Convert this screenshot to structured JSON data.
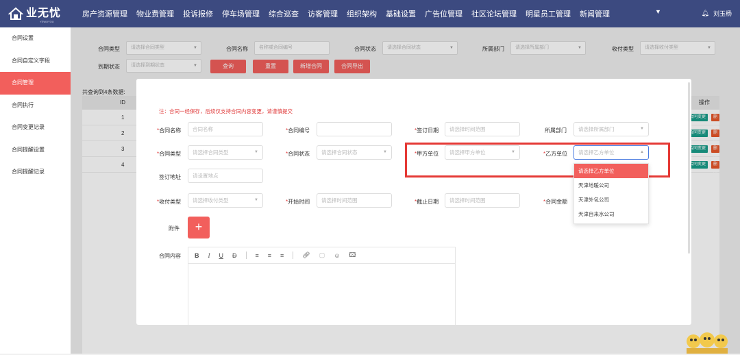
{
  "app": {
    "brand": "业无忧",
    "brand_sub": "YEWUYOU",
    "user": "刘玉杨"
  },
  "nav": [
    "房产资源管理",
    "物业费管理",
    "投诉报修",
    "停车场管理",
    "综合巡查",
    "访客管理",
    "组织架构",
    "基础设置",
    "广告位管理",
    "社区论坛管理",
    "明星员工管理",
    "新闻管理"
  ],
  "sidebar": [
    "合同设置",
    "合同自定义字段",
    "合同管理",
    "合同执行",
    "合同变更记录",
    "合同提醒设置",
    "合同提醒记录"
  ],
  "filters": {
    "contract_type_label": "合同类型",
    "contract_type_ph": "请选择合同类型",
    "contract_name_label": "合同名称",
    "contract_name_ph": "名称或合同编号",
    "contract_status_label": "合同状态",
    "contract_status_ph": "请选择合同状态",
    "dept_label": "所属部门",
    "dept_ph": "请选择所属部门",
    "pay_type_label": "收付类型",
    "pay_type_ph": "请选择收付类型",
    "expire_label": "到期状态",
    "expire_ph": "请选择到期状态",
    "btn_query": "查询",
    "btn_reset": "重置",
    "btn_add": "新增合同",
    "btn_export": "合同导出"
  },
  "table": {
    "summary": "共查询到4条数据:",
    "col_id": "ID",
    "col_action": "操作",
    "rows": [
      "1",
      "2",
      "3",
      "4"
    ],
    "btn_change": "合同变更",
    "btn_delete": "删除"
  },
  "modal": {
    "notice": "注：合同一经保存，后续仅支持合同内容变更，请谨慎提交",
    "name_label": "合同名称",
    "name_ph": "合同名称",
    "no_label": "合同编号",
    "sign_date_label": "签订日期",
    "sign_date_ph": "请选择时间范围",
    "dept_label": "所属部门",
    "dept_ph": "请选择所属部门",
    "type_label": "合同类型",
    "type_ph": "请选择合同类型",
    "status_label": "合同状态",
    "status_ph": "请选择合同状态",
    "party_a_label": "甲方单位",
    "party_a_ph": "请选择甲方单位",
    "party_b_label": "乙方单位",
    "party_b_ph": "请选择乙方单位",
    "addr_label": "签订地址",
    "addr_ph": "请设置地点",
    "pay_type_label": "收付类型",
    "pay_type_ph": "请选择收付类型",
    "start_label": "开始时间",
    "start_ph": "请选择时间范围",
    "end_label": "截止日期",
    "end_ph": "请选择时间范围",
    "amount_label": "合同金额",
    "attach_label": "附件",
    "content_label": "合同内容"
  },
  "dropdown": [
    "请选择乙方单位",
    "天津地暖公司",
    "天津外包公司",
    "天津自来水公司"
  ]
}
